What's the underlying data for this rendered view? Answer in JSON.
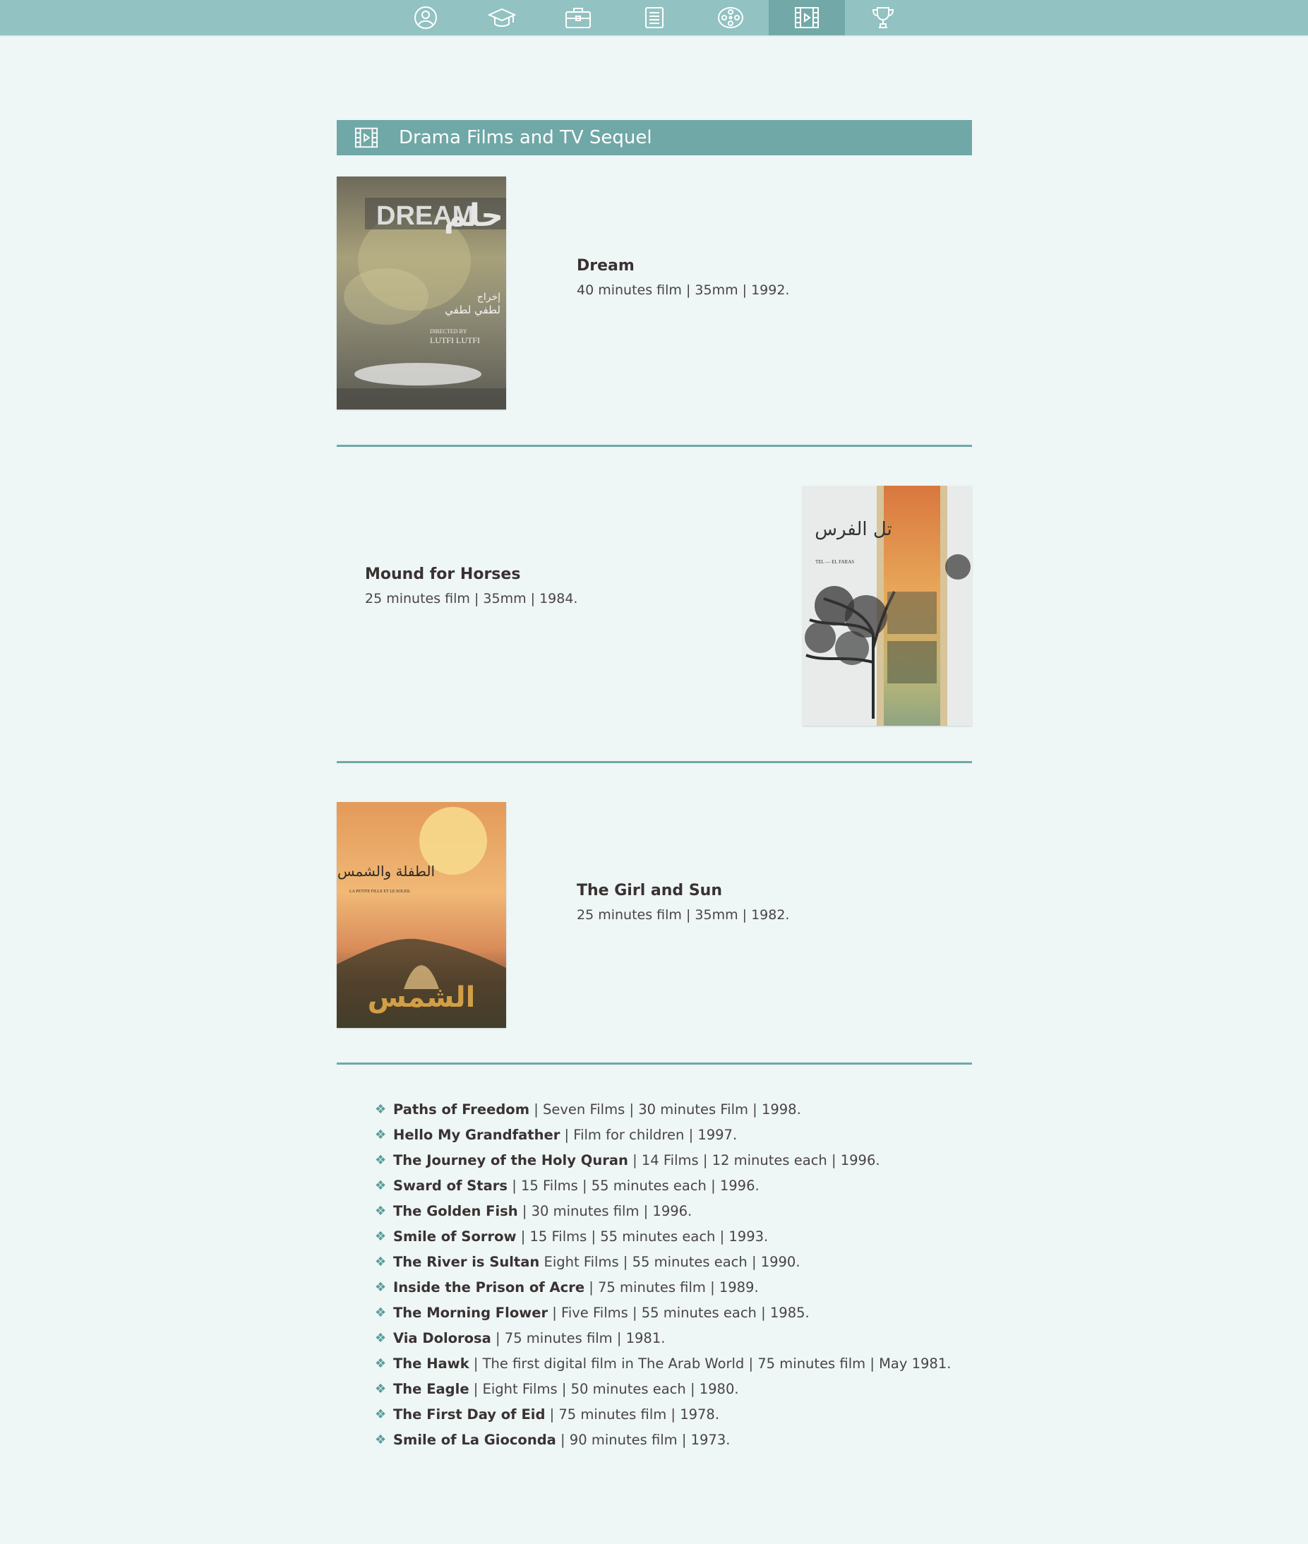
{
  "nav": {
    "items": [
      {
        "icon": "user-icon",
        "active": false
      },
      {
        "icon": "graduation-cap-icon",
        "active": false
      },
      {
        "icon": "briefcase-icon",
        "active": false
      },
      {
        "icon": "book-icon",
        "active": false
      },
      {
        "icon": "film-reel-icon",
        "active": false
      },
      {
        "icon": "film-strip-icon",
        "active": true
      },
      {
        "icon": "trophy-icon",
        "active": false
      }
    ]
  },
  "section": {
    "icon": "film-strip-icon",
    "title": "Drama Films and TV Sequel"
  },
  "featured": [
    {
      "title": "Dream",
      "meta": "40 minutes film | 35mm | 1992.",
      "poster": {
        "texts": [
          "DREAM",
          "حلم",
          "إخراج",
          "لطفي لطفي",
          "DIRECTED BY",
          "LUTFI LUTFI"
        ]
      }
    },
    {
      "title": "Mound for Horses",
      "meta": "25 minutes film | 35mm | 1984.",
      "poster": {
        "texts": [
          "تل الفرس",
          "TEL — EL FARAS"
        ]
      }
    },
    {
      "title": "The Girl and Sun",
      "meta": "25 minutes film | 35mm | 1982.",
      "poster": {
        "texts": [
          "الطفلة والشمس",
          "LA PETITE FILLE ET LE SOLEIL",
          "الشمس"
        ]
      }
    }
  ],
  "list": [
    {
      "title": "Paths of Freedom",
      "rest": " | Seven Films | 30 minutes Film | 1998."
    },
    {
      "title": "Hello My Grandfather",
      "rest": " | Film for children | 1997."
    },
    {
      "title": "The Journey of the Holy Quran",
      "rest": " | 14 Films | 12 minutes each | 1996."
    },
    {
      "title": "Sward of Stars",
      "rest": " | 15 Films | 55 minutes each | 1996."
    },
    {
      "title": "The Golden Fish",
      "rest": " | 30 minutes film | 1996."
    },
    {
      "title": "Smile of Sorrow",
      "rest": " | 15 Films | 55 minutes each | 1993."
    },
    {
      "title": "The River is Sultan",
      "rest": " Eight Films | 55 minutes each | 1990."
    },
    {
      "title": "Inside the Prison of Acre",
      "rest": " | 75 minutes film | 1989."
    },
    {
      "title": "The Morning Flower",
      "rest": " | Five Films | 55 minutes each | 1985."
    },
    {
      "title": "Via Dolorosa",
      "rest": " | 75 minutes film | 1981."
    },
    {
      "title": "The Hawk",
      "rest": " | The first digital film in The Arab World | 75 minutes film | May 1981."
    },
    {
      "title": "The Eagle",
      "rest": " | Eight Films | 50 minutes each | 1980."
    },
    {
      "title": "The First Day of Eid",
      "rest": " | 75 minutes film | 1978."
    },
    {
      "title": "Smile of La Gioconda",
      "rest": " | 90 minutes film | 1973."
    }
  ],
  "bullet": "❖",
  "colors": {
    "nav": "#92c2c1",
    "nav_active": "#72a9a8",
    "accent": "#6fa8a6",
    "page": "#eef6f6"
  }
}
